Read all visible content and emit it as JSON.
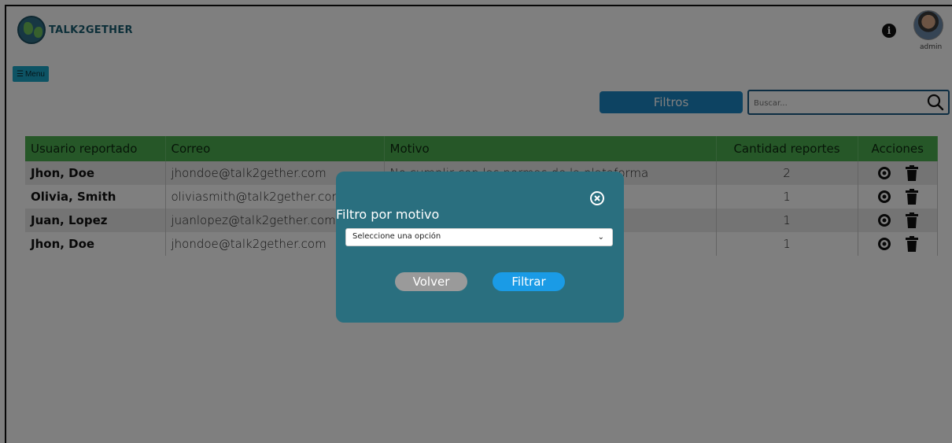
{
  "app": {
    "brand": "TALK2GETHER",
    "user_label": "admin"
  },
  "toolbar": {
    "menu_label": "Menu",
    "filters_label": "Filtros",
    "search_placeholder": "Buscar..."
  },
  "table": {
    "headers": [
      "Usuario reportado",
      "Correo",
      "Motivo",
      "Cantidad reportes",
      "Acciones"
    ],
    "rows": [
      {
        "user": "Jhon, Doe",
        "email": "jhondoe@talk2gether.com",
        "motivo": "No cumplir con las normas de la plataforma",
        "count": "2"
      },
      {
        "user": "Olivia, Smith",
        "email": "oliviasmith@talk2gether.com",
        "motivo": "",
        "count": "1"
      },
      {
        "user": "Juan, Lopez",
        "email": "juanlopez@talk2gether.com",
        "motivo": "",
        "count": "1"
      },
      {
        "user": "Jhon, Doe",
        "email": "jhondoe@talk2gether.com",
        "motivo": "",
        "count": "1"
      }
    ]
  },
  "modal": {
    "title": "Filtro por motivo",
    "select_value": "Seleccione una opción",
    "back_label": "Volver",
    "apply_label": "Filtrar"
  },
  "colors": {
    "header_green": "#4caf50",
    "modal_bg": "#2a6f7f",
    "primary_blue": "#1b86c4",
    "menu_cyan": "#1aa6c9"
  },
  "icons": [
    "info-icon",
    "search-icon",
    "eye-icon",
    "trash-icon",
    "close-icon",
    "chevron-down-icon"
  ]
}
